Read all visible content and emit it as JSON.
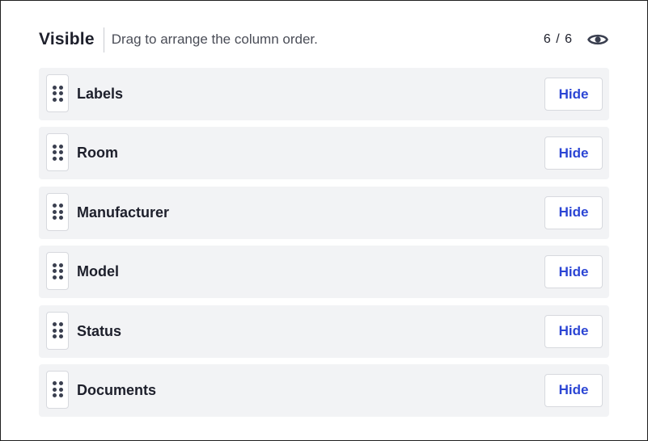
{
  "header": {
    "title": "Visible",
    "subtitle": "Drag to arrange the column order.",
    "count": "6 / 6",
    "toggle_icon": "eye-icon"
  },
  "columns": [
    {
      "label": "Labels",
      "action": "Hide"
    },
    {
      "label": "Room",
      "action": "Hide"
    },
    {
      "label": "Manufacturer",
      "action": "Hide"
    },
    {
      "label": "Model",
      "action": "Hide"
    },
    {
      "label": "Status",
      "action": "Hide"
    },
    {
      "label": "Documents",
      "action": "Hide"
    }
  ],
  "colors": {
    "accent": "#2b45d4",
    "row_bg": "#f2f3f5",
    "text": "#1d1f2b"
  }
}
